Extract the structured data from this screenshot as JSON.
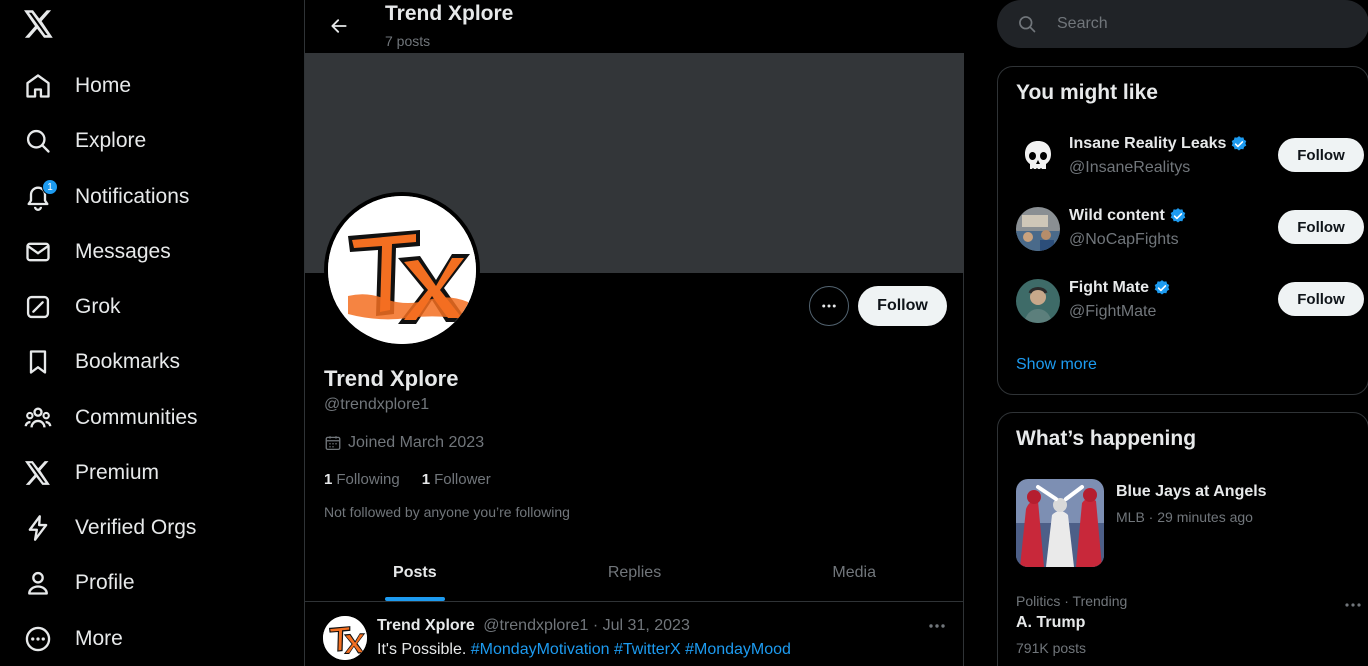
{
  "sidebar": {
    "logo_icon": "x-logo-icon",
    "items": [
      {
        "label": "Home",
        "icon": "home-icon"
      },
      {
        "label": "Explore",
        "icon": "search-icon"
      },
      {
        "label": "Notifications",
        "icon": "bell-icon",
        "badge": "1"
      },
      {
        "label": "Messages",
        "icon": "envelope-icon"
      },
      {
        "label": "Grok",
        "icon": "grok-icon"
      },
      {
        "label": "Bookmarks",
        "icon": "bookmark-icon"
      },
      {
        "label": "Communities",
        "icon": "communities-icon"
      },
      {
        "label": "Premium",
        "icon": "x-logo-icon"
      },
      {
        "label": "Verified Orgs",
        "icon": "lightning-icon"
      },
      {
        "label": "Profile",
        "icon": "person-icon"
      },
      {
        "label": "More",
        "icon": "more-circle-icon"
      }
    ]
  },
  "header": {
    "title": "Trend Xplore",
    "post_count": "7 posts"
  },
  "profile": {
    "name": "Trend Xplore",
    "handle": "@trendxplore1",
    "joined": "Joined March 2023",
    "following_count": "1",
    "following_label": "Following",
    "followers_count": "1",
    "followers_label": "Follower",
    "not_followed": "Not followed by anyone you’re following",
    "follow_label": "Follow"
  },
  "tabs": [
    {
      "label": "Posts",
      "active": true
    },
    {
      "label": "Replies",
      "active": false
    },
    {
      "label": "Media",
      "active": false
    }
  ],
  "post": {
    "name": "Trend Xplore",
    "meta": "@trendxplore1 · Jul 31, 2023",
    "text": "It's Possible.",
    "hashtags": [
      "#MondayMotivation",
      "#TwitterX",
      "#MondayMood"
    ]
  },
  "search": {
    "placeholder": "Search"
  },
  "who_to_follow": {
    "title": "You might like",
    "items": [
      {
        "name": "Insane Reality Leaks",
        "handle": "@InsaneRealitys",
        "follow_label": "Follow"
      },
      {
        "name": "Wild content",
        "handle": "@NoCapFights",
        "follow_label": "Follow"
      },
      {
        "name": "Fight Mate",
        "handle": "@FightMate",
        "follow_label": "Follow"
      }
    ],
    "show_more": "Show more"
  },
  "trends": {
    "title": "What’s happening",
    "items": [
      {
        "title": "Blue Jays at Angels",
        "meta": "MLB · 29 minutes ago"
      },
      {
        "category": "Politics · Trending",
        "title": "A. Trump",
        "posts": "791K posts"
      }
    ]
  },
  "colors": {
    "accent": "#1d9bf0",
    "background": "#000000",
    "muted_text": "#71767b",
    "brand_orange": "#f36f21"
  }
}
